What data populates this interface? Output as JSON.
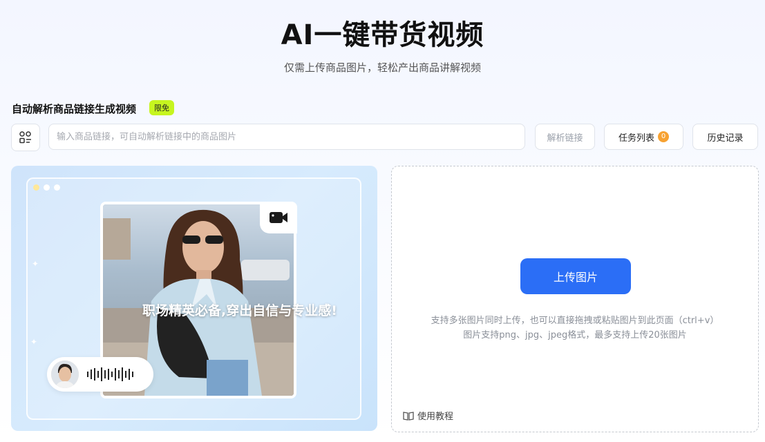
{
  "hero": {
    "title": "AI一键带货视频",
    "subtitle": "仅需上传商品图片，轻松产出商品讲解视频"
  },
  "link_section": {
    "title": "自动解析商品链接生成视频",
    "badge": "限免",
    "input_placeholder": "输入商品链接，可自动解析链接中的商品图片",
    "parse_button": "解析链接",
    "tasks_button": "任务列表",
    "tasks_count": "0",
    "history_button": "历史记录",
    "scan_icon": "scan-list-icon"
  },
  "preview": {
    "caption": "职场精英必备,穿出自信与专业感!",
    "camera_icon": "video-camera-icon"
  },
  "upload": {
    "button": "上传图片",
    "hint_line1": "支持多张图片同时上传，也可以直接拖拽或粘贴图片到此页面（ctrl+v）",
    "hint_line2": "图片支持png、jpg、jpeg格式，最多支持上传20张图片",
    "tutorial": "使用教程",
    "tutorial_icon": "open-book-icon"
  },
  "colors": {
    "accent": "#2b6ef6",
    "badge": "#c6f51f",
    "count_badge": "#f7a232"
  }
}
